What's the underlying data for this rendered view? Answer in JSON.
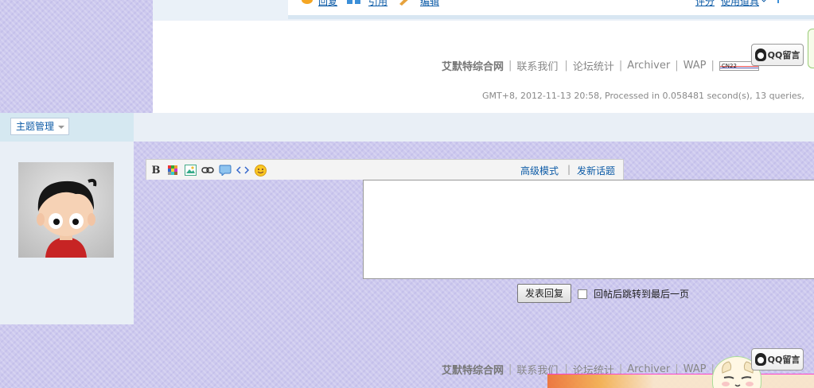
{
  "toolbar_top": {
    "reply_label": "回复",
    "quote_label": "引用",
    "edit_label": "编辑",
    "rate_label": "评分",
    "tools_label": "使用道具"
  },
  "footer": {
    "brand": "艾默特综合网",
    "links": [
      "联系我们",
      "论坛统计",
      "Archiver",
      "WAP"
    ],
    "cnzz_label": "CN22",
    "qq_label": "QQ留言",
    "gmt_text": "GMT+8, 2012-11-13 20:58, Processed in 0.058481 second(s), 13 queries,"
  },
  "thread_manage": {
    "label": "主题管理"
  },
  "editor": {
    "bold_label": "B",
    "advanced_mode": "高级模式",
    "new_topic": "发新话题",
    "submit_label": "发表回复",
    "jump_label": "回帖后跳转到最后一页"
  },
  "colors": {
    "link_blue": "#0b5aa6",
    "background_lavender": "#cdc9ee",
    "panel_light_blue": "#e9eff6"
  }
}
